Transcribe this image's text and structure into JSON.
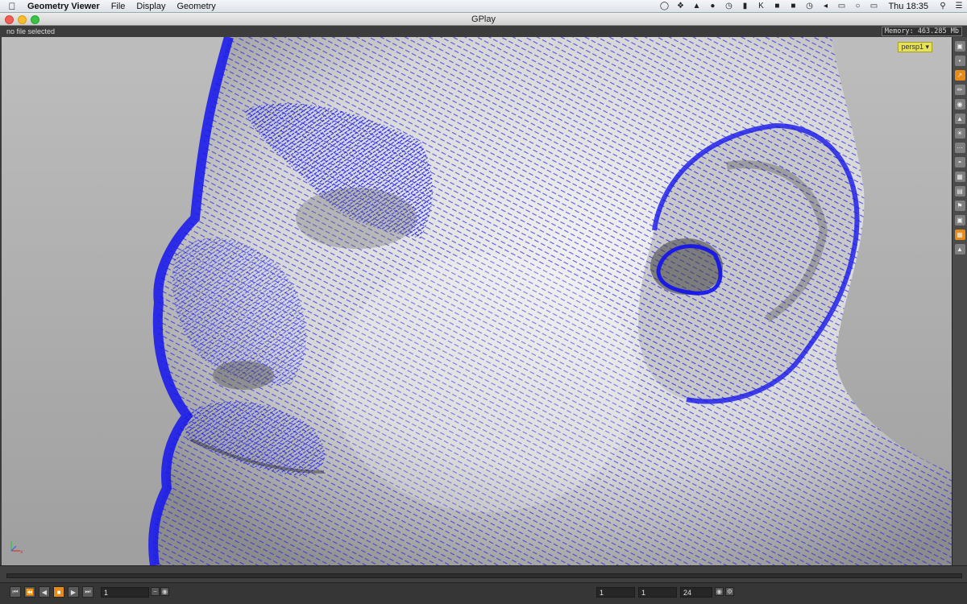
{
  "menubar": {
    "apple_icon": "apple-icon",
    "app_name": "Geometry Viewer",
    "menus": [
      "File",
      "Display",
      "Geometry"
    ],
    "clock": "Thu 18:35"
  },
  "window": {
    "title": "GPlay"
  },
  "status": {
    "file_text": "no file selected",
    "memory": "Memory: 463.285 Mb"
  },
  "viewport": {
    "camera": "persp1 ▾"
  },
  "timeline": {
    "current_frame": "1",
    "range_start": "1",
    "range_current": "1",
    "range_end": "24"
  },
  "colors": {
    "accent": "#e68a18",
    "normals": "#1f1fe0",
    "camera_tag": "#e6e25b"
  }
}
